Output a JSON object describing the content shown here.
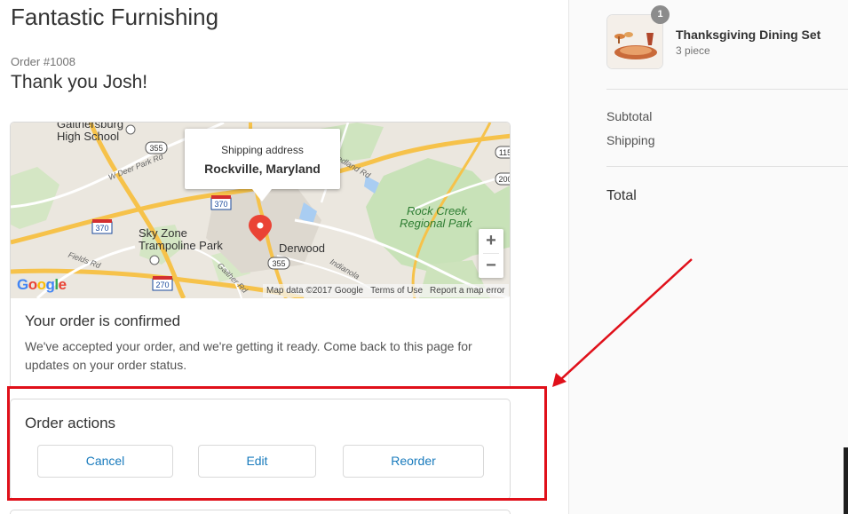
{
  "shop": {
    "title": "Fantastic Furnishing"
  },
  "order": {
    "number": "Order #1008",
    "thank_you": "Thank you Josh!"
  },
  "map": {
    "tooltip_label": "Shipping address",
    "tooltip_city": "Rockville, Maryland",
    "zoom_in": "+",
    "zoom_out": "−",
    "attribution": "Map data ©2017 Google",
    "terms": "Terms of Use",
    "report": "Report a map error",
    "google_logo": [
      "G",
      "o",
      "o",
      "g",
      "l",
      "e"
    ],
    "labels": {
      "gaithersburg": "Gaithersburg",
      "high_school": "High School",
      "sky_zone": "Sky Zone",
      "trampoline": "Trampoline Park",
      "derwood": "Derwood",
      "rock_creek": "Rock Creek",
      "regional_park": "Regional Park",
      "w_deer_park": "W Deer Park Rd",
      "fields_rd": "Fields Rd",
      "gaither_rd": "Gaither Rd",
      "indianola": "Indianola",
      "redland": "edland Rd"
    },
    "shields": [
      "355",
      "370",
      "370",
      "355",
      "270",
      "115",
      "200"
    ]
  },
  "confirmation": {
    "title": "Your order is confirmed",
    "text": "We've accepted your order, and we're getting it ready. Come back to this page for updates on your order status."
  },
  "actions": {
    "title": "Order actions",
    "cancel": "Cancel",
    "edit": "Edit",
    "reorder": "Reorder"
  },
  "summary": {
    "product_name": "Thanksgiving Dining Set",
    "product_variant": "3 piece",
    "quantity": "1",
    "subtotal_label": "Subtotal",
    "shipping_label": "Shipping",
    "total_label": "Total"
  },
  "colors": {
    "accent_link": "#197bbd",
    "highlight": "#e0101a",
    "map_pin": "#ea4335"
  }
}
